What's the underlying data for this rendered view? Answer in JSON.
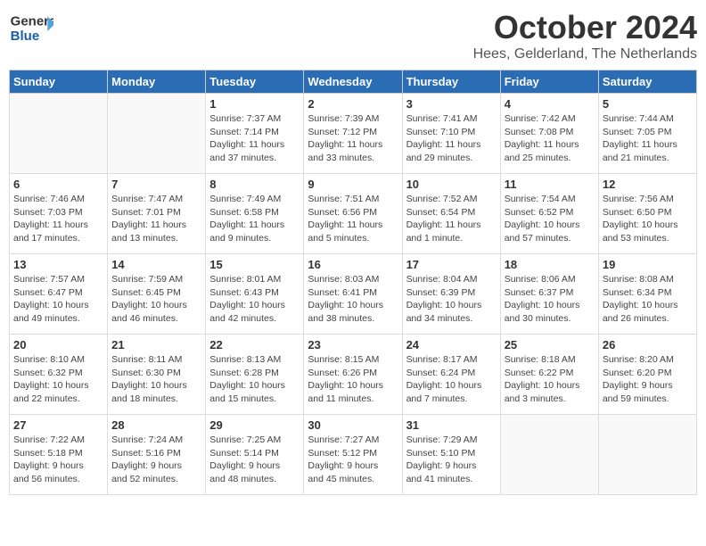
{
  "header": {
    "logo": {
      "general": "General",
      "blue": "Blue"
    },
    "title": "October 2024",
    "location": "Hees, Gelderland, The Netherlands"
  },
  "weekdays": [
    "Sunday",
    "Monday",
    "Tuesday",
    "Wednesday",
    "Thursday",
    "Friday",
    "Saturday"
  ],
  "weeks": [
    [
      {
        "day": "",
        "info": ""
      },
      {
        "day": "",
        "info": ""
      },
      {
        "day": "1",
        "info": "Sunrise: 7:37 AM\nSunset: 7:14 PM\nDaylight: 11 hours\nand 37 minutes."
      },
      {
        "day": "2",
        "info": "Sunrise: 7:39 AM\nSunset: 7:12 PM\nDaylight: 11 hours\nand 33 minutes."
      },
      {
        "day": "3",
        "info": "Sunrise: 7:41 AM\nSunset: 7:10 PM\nDaylight: 11 hours\nand 29 minutes."
      },
      {
        "day": "4",
        "info": "Sunrise: 7:42 AM\nSunset: 7:08 PM\nDaylight: 11 hours\nand 25 minutes."
      },
      {
        "day": "5",
        "info": "Sunrise: 7:44 AM\nSunset: 7:05 PM\nDaylight: 11 hours\nand 21 minutes."
      }
    ],
    [
      {
        "day": "6",
        "info": "Sunrise: 7:46 AM\nSunset: 7:03 PM\nDaylight: 11 hours\nand 17 minutes."
      },
      {
        "day": "7",
        "info": "Sunrise: 7:47 AM\nSunset: 7:01 PM\nDaylight: 11 hours\nand 13 minutes."
      },
      {
        "day": "8",
        "info": "Sunrise: 7:49 AM\nSunset: 6:58 PM\nDaylight: 11 hours\nand 9 minutes."
      },
      {
        "day": "9",
        "info": "Sunrise: 7:51 AM\nSunset: 6:56 PM\nDaylight: 11 hours\nand 5 minutes."
      },
      {
        "day": "10",
        "info": "Sunrise: 7:52 AM\nSunset: 6:54 PM\nDaylight: 11 hours\nand 1 minute."
      },
      {
        "day": "11",
        "info": "Sunrise: 7:54 AM\nSunset: 6:52 PM\nDaylight: 10 hours\nand 57 minutes."
      },
      {
        "day": "12",
        "info": "Sunrise: 7:56 AM\nSunset: 6:50 PM\nDaylight: 10 hours\nand 53 minutes."
      }
    ],
    [
      {
        "day": "13",
        "info": "Sunrise: 7:57 AM\nSunset: 6:47 PM\nDaylight: 10 hours\nand 49 minutes."
      },
      {
        "day": "14",
        "info": "Sunrise: 7:59 AM\nSunset: 6:45 PM\nDaylight: 10 hours\nand 46 minutes."
      },
      {
        "day": "15",
        "info": "Sunrise: 8:01 AM\nSunset: 6:43 PM\nDaylight: 10 hours\nand 42 minutes."
      },
      {
        "day": "16",
        "info": "Sunrise: 8:03 AM\nSunset: 6:41 PM\nDaylight: 10 hours\nand 38 minutes."
      },
      {
        "day": "17",
        "info": "Sunrise: 8:04 AM\nSunset: 6:39 PM\nDaylight: 10 hours\nand 34 minutes."
      },
      {
        "day": "18",
        "info": "Sunrise: 8:06 AM\nSunset: 6:37 PM\nDaylight: 10 hours\nand 30 minutes."
      },
      {
        "day": "19",
        "info": "Sunrise: 8:08 AM\nSunset: 6:34 PM\nDaylight: 10 hours\nand 26 minutes."
      }
    ],
    [
      {
        "day": "20",
        "info": "Sunrise: 8:10 AM\nSunset: 6:32 PM\nDaylight: 10 hours\nand 22 minutes."
      },
      {
        "day": "21",
        "info": "Sunrise: 8:11 AM\nSunset: 6:30 PM\nDaylight: 10 hours\nand 18 minutes."
      },
      {
        "day": "22",
        "info": "Sunrise: 8:13 AM\nSunset: 6:28 PM\nDaylight: 10 hours\nand 15 minutes."
      },
      {
        "day": "23",
        "info": "Sunrise: 8:15 AM\nSunset: 6:26 PM\nDaylight: 10 hours\nand 11 minutes."
      },
      {
        "day": "24",
        "info": "Sunrise: 8:17 AM\nSunset: 6:24 PM\nDaylight: 10 hours\nand 7 minutes."
      },
      {
        "day": "25",
        "info": "Sunrise: 8:18 AM\nSunset: 6:22 PM\nDaylight: 10 hours\nand 3 minutes."
      },
      {
        "day": "26",
        "info": "Sunrise: 8:20 AM\nSunset: 6:20 PM\nDaylight: 9 hours\nand 59 minutes."
      }
    ],
    [
      {
        "day": "27",
        "info": "Sunrise: 7:22 AM\nSunset: 5:18 PM\nDaylight: 9 hours\nand 56 minutes."
      },
      {
        "day": "28",
        "info": "Sunrise: 7:24 AM\nSunset: 5:16 PM\nDaylight: 9 hours\nand 52 minutes."
      },
      {
        "day": "29",
        "info": "Sunrise: 7:25 AM\nSunset: 5:14 PM\nDaylight: 9 hours\nand 48 minutes."
      },
      {
        "day": "30",
        "info": "Sunrise: 7:27 AM\nSunset: 5:12 PM\nDaylight: 9 hours\nand 45 minutes."
      },
      {
        "day": "31",
        "info": "Sunrise: 7:29 AM\nSunset: 5:10 PM\nDaylight: 9 hours\nand 41 minutes."
      },
      {
        "day": "",
        "info": ""
      },
      {
        "day": "",
        "info": ""
      }
    ]
  ]
}
